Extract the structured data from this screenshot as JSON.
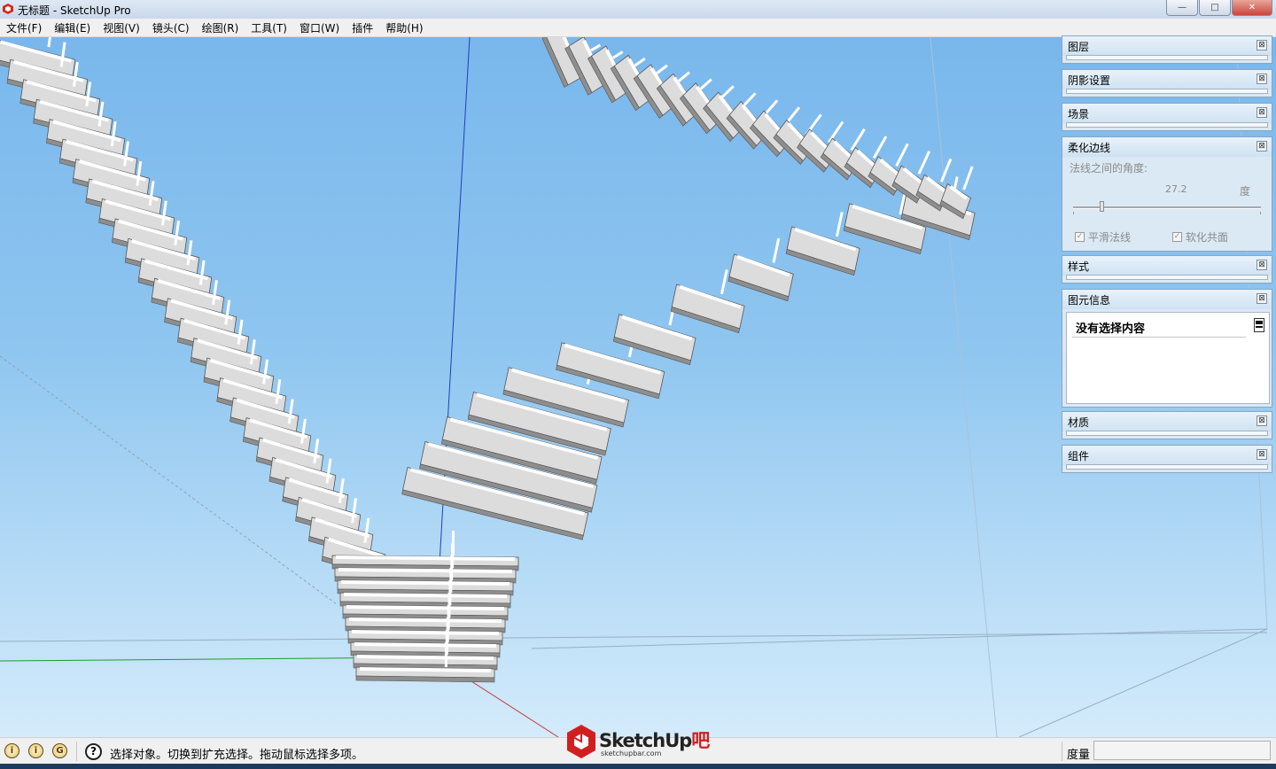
{
  "window": {
    "title": "无标题 - SketchUp Pro",
    "minimize_glyph": "—",
    "maximize_glyph": "□",
    "close_glyph": "✕"
  },
  "menu": {
    "items": [
      "文件(F)",
      "编辑(E)",
      "视图(V)",
      "镜头(C)",
      "绘图(R)",
      "工具(T)",
      "窗口(W)",
      "插件",
      "帮助(H)"
    ]
  },
  "tray": {
    "layers": {
      "title": "图层"
    },
    "shadows": {
      "title": "阴影设置"
    },
    "scenes": {
      "title": "场景"
    },
    "soften_edges": {
      "title": "柔化边线",
      "angle_label": "法线之间的角度:",
      "angle_value": "27.2",
      "angle_unit": "度",
      "slider_fraction": 0.151,
      "smooth_normals_label": "平滑法线",
      "smooth_normals_checked": true,
      "soften_coplanar_label": "软化共面",
      "soften_coplanar_checked": true
    },
    "styles": {
      "title": "样式"
    },
    "entity_info": {
      "title": "图元信息",
      "status": "没有选择内容"
    },
    "materials": {
      "title": "材质"
    },
    "components": {
      "title": "组件"
    },
    "close_glyph": "⊠"
  },
  "status": {
    "hint": "选择对象。切换到扩充选择。拖动鼠标选择多项。",
    "measurements_label": "度量",
    "help_glyph": "?",
    "icons": [
      "info-geo-icon",
      "credits-icon",
      "google-sign-in-icon"
    ],
    "icon_glyphs": [
      "i",
      "i",
      "G"
    ]
  },
  "watermark": {
    "brand": "SketchUp",
    "brand_suffix": "吧",
    "url": "sketchupbar.com"
  },
  "colors": {
    "sky_top": "#79b7ec",
    "sky_bottom": "#d4ebfb",
    "axis_blue": "#1f3fbf",
    "axis_green": "#1a9c2a",
    "axis_red": "#c43a3a",
    "panel_bg": "#dbe9f4",
    "logo_red": "#d11f1f"
  }
}
